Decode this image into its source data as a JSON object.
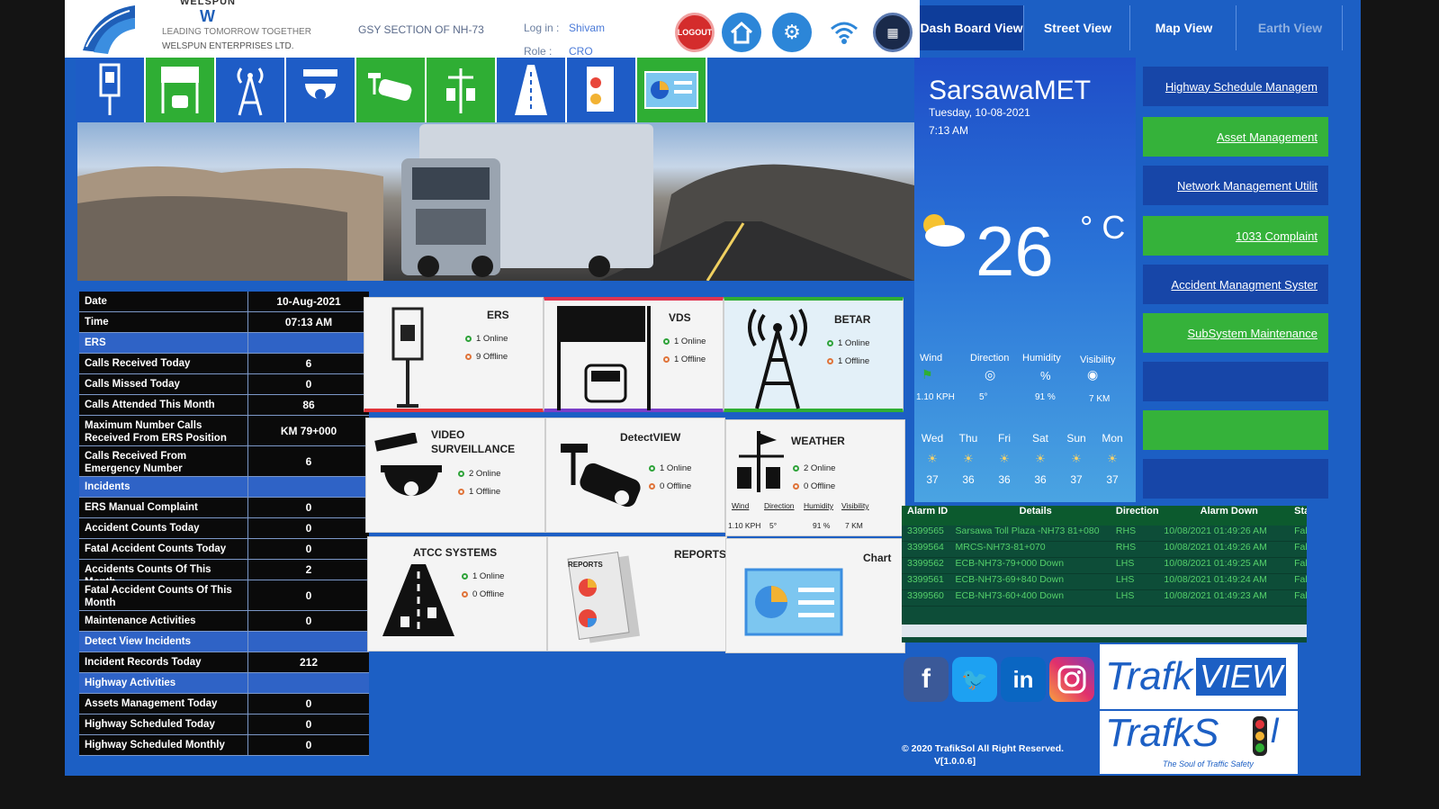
{
  "header": {
    "brand_top": "WELSPUN",
    "brand_mark": "W",
    "brand_tagline": "LEADING TOMORROW TOGETHER",
    "brand_company": "WELSPUN ENTERPRISES LTD.",
    "section": "GSY SECTION OF NH-73",
    "login_label": "Log in :",
    "login_value": "Shivam",
    "role_label": "Role :",
    "role_value": "CRO",
    "logout_label": "LOGOUT"
  },
  "tabs": [
    "Dash Board View",
    "Street View",
    "Map View",
    "Earth View"
  ],
  "info": {
    "date_label": "Date",
    "date_value": "10-Aug-2021",
    "time_label": "Time",
    "time_value": "07:13 AM",
    "ers_header": "ERS",
    "calls_received_label": "Calls Received Today",
    "calls_received": "6",
    "calls_missed_label": "Calls Missed Today",
    "calls_missed": "0",
    "calls_month_label": "Calls Attended This Month",
    "calls_month": "86",
    "max_calls_label": "Maximum Number Calls Received From ERS Position",
    "max_calls": "KM 79+000",
    "emergency_label": "Calls Received From Emergency Number",
    "emergency": "6",
    "incidents_header": "Incidents",
    "ers_manual_label": "ERS Manual Complaint",
    "ers_manual": "0",
    "accident_today_label": "Accident Counts Today",
    "accident_today": "0",
    "fatal_today_label": "Fatal Accident Counts Today",
    "fatal_today": "0",
    "accident_month_label": "Accidents Counts Of This Month",
    "accident_month": "2",
    "fatal_month_label": "Fatal Accident Counts Of This Month",
    "fatal_month": "0",
    "maintenance_label": "Maintenance Activities",
    "maintenance": "0",
    "detect_header": "Detect View Incidents",
    "incident_records_label": "Incident Records Today",
    "incident_records": "212",
    "highway_header": "Highway Activities",
    "assets_label": "Assets Management Today",
    "assets": "0",
    "hw_today_label": "Highway Scheduled Today",
    "hw_today": "0",
    "hw_month_label": "Highway Scheduled Monthly",
    "hw_month": "0"
  },
  "tiles": {
    "ers": {
      "title": "ERS",
      "online": "1 Online",
      "offline": "9 Offline"
    },
    "vds": {
      "title": "VDS",
      "online": "1 Online",
      "offline": "1 Offline"
    },
    "betar": {
      "title": "BETAR",
      "online": "1 Online",
      "offline": "1 Offline"
    },
    "video": {
      "title": "VIDEO SURVEILLANCE",
      "online": "2 Online",
      "offline": "1 Offline"
    },
    "detect": {
      "title": "DetectVIEW",
      "online": "1 Online",
      "offline": "0 Offline"
    },
    "weather": {
      "title": "WEATHER",
      "online": "2 Online",
      "offline": "0 Offline",
      "h_wind": "Wind",
      "h_dir": "Direction",
      "h_hum": "Humidity",
      "h_vis": "Visibility",
      "v_wind": "1.10 KPH",
      "v_dir": "5°",
      "v_hum": "91 %",
      "v_vis": "7 KM"
    },
    "atcc": {
      "title": "ATCC SYSTEMS",
      "online": "1 Online",
      "offline": "0 Offline"
    },
    "reports": {
      "title": "REPORTS",
      "book_label": "REPORTS"
    },
    "chart": {
      "title": "Chart"
    }
  },
  "weather_panel": {
    "station": "SarsawaMET",
    "date": "Tuesday, 10-08-2021",
    "time": "7:13 AM",
    "temp": "26",
    "unit": "° C",
    "h_wind": "Wind",
    "h_dir": "Direction",
    "h_hum": "Humidity",
    "h_vis": "Visibility",
    "v_wind": "1.10 KPH",
    "v_dir": "5°",
    "v_hum": "91 %",
    "v_vis": "7 KM",
    "days": [
      {
        "d": "Wed",
        "t": "37"
      },
      {
        "d": "Thu",
        "t": "36"
      },
      {
        "d": "Fri",
        "t": "36"
      },
      {
        "d": "Sat",
        "t": "36"
      },
      {
        "d": "Sun",
        "t": "37"
      },
      {
        "d": "Mon",
        "t": "37"
      }
    ]
  },
  "menu": [
    "Highway Schedule Managem",
    "Asset Management",
    "Network Management Utilit",
    "1033 Complaint",
    "Accident Managment Syster",
    "SubSystem Maintenance",
    "",
    "",
    ""
  ],
  "alarms": {
    "headers": [
      "Alarm ID",
      "Details",
      "Direction",
      "Alarm Down",
      "Sta"
    ],
    "rows": [
      [
        "3399565",
        "Sarsawa Toll Plaza -NH73 81+080",
        "RHS",
        "10/08/2021 01:49:26 AM",
        "Fal"
      ],
      [
        "3399564",
        "MRCS-NH73-81+070",
        "RHS",
        "10/08/2021 01:49:26 AM",
        "Fal"
      ],
      [
        "3399562",
        "ECB-NH73-79+000 Down",
        "LHS",
        "10/08/2021 01:49:25 AM",
        "Fal"
      ],
      [
        "3399561",
        "ECB-NH73-69+840 Down",
        "LHS",
        "10/08/2021 01:49:24 AM",
        "Fal"
      ],
      [
        "3399560",
        "ECB-NH73-60+400 Down",
        "LHS",
        "10/08/2021 01:49:23 AM",
        "Fal"
      ]
    ]
  },
  "footer": {
    "copyright": "© 2020 TrafikSol All Right Reserved.",
    "version": "V[1.0.0.6]",
    "logo1_a": "Trafk",
    "logo1_b": "VIEW",
    "logo2": "TrafkS",
    "tagline": "The Soul of Traffic Safety"
  },
  "colors": {
    "bg_blue": "#1c5fc4",
    "menu_green": "#35b23a",
    "menu_blue": "#1746a8",
    "online": "#2fa33a",
    "offline": "#e0743a"
  }
}
